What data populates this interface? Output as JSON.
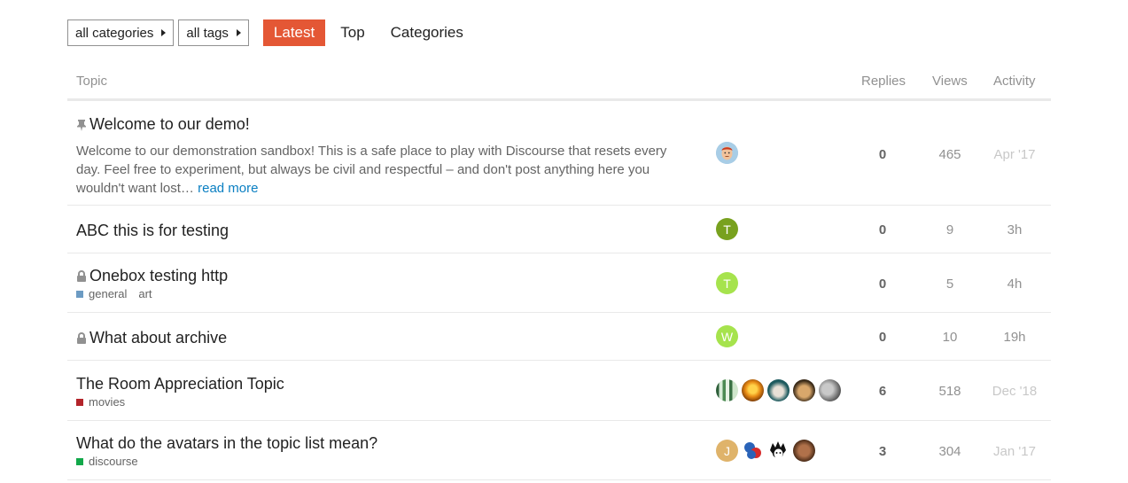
{
  "nav": {
    "categories_dropdown": "all categories",
    "tags_dropdown": "all tags",
    "tabs": [
      {
        "label": "Latest",
        "active": true
      },
      {
        "label": "Top",
        "active": false
      },
      {
        "label": "Categories",
        "active": false
      }
    ]
  },
  "accent_color": "#e45735",
  "columns": {
    "topic": "Topic",
    "replies": "Replies",
    "views": "Views",
    "activity": "Activity"
  },
  "topics": [
    {
      "title": "Welcome to our demo!",
      "status_icon": "pin-icon",
      "excerpt": "Welcome to our demonstration sandbox! This is a safe place to play with Discourse that resets every day. Feel free to experiment, but always be civil and respectful – and don't post anything here you wouldn't want lost…",
      "read_more": "read more",
      "replies": "0",
      "views": "465",
      "activity": "Apr '17"
    },
    {
      "title": "ABC this is for testing",
      "avatar_letters": [
        "T"
      ],
      "replies": "0",
      "views": "9",
      "activity": "3h"
    },
    {
      "title": "Onebox testing http",
      "status_icon": "lock-icon",
      "category": {
        "name": "general",
        "color": "#6c9bc3"
      },
      "tags": [
        "art"
      ],
      "avatar_letters": [
        "T"
      ],
      "replies": "0",
      "views": "5",
      "activity": "4h"
    },
    {
      "title": "What about archive",
      "status_icon": "lock-icon",
      "avatar_letters": [
        "W"
      ],
      "replies": "0",
      "views": "10",
      "activity": "19h"
    },
    {
      "title": "The Room Appreciation Topic",
      "category": {
        "name": "movies",
        "color": "#b3242a"
      },
      "replies": "6",
      "views": "518",
      "activity": "Dec '18"
    },
    {
      "title": "What do the avatars in the topic list mean?",
      "category": {
        "name": "discourse",
        "color": "#12a84a"
      },
      "avatar_letters": [
        "J"
      ],
      "replies": "3",
      "views": "304",
      "activity": "Jan '17"
    }
  ]
}
